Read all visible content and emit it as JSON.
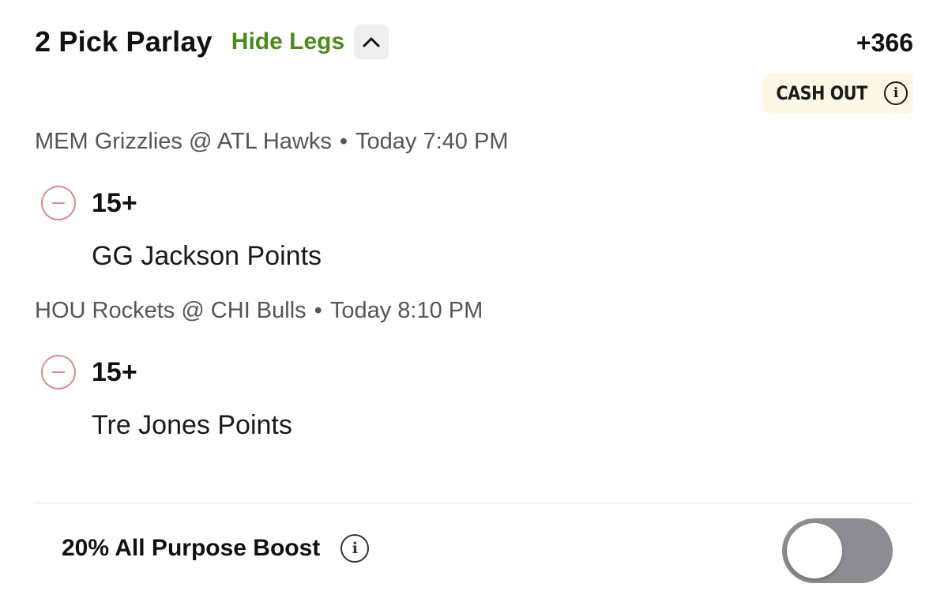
{
  "parlay": {
    "title": "2 Pick Parlay",
    "hide_legs_label": "Hide Legs",
    "chevron_icon": "chevron-up-icon",
    "odds": "+366",
    "cashout_label": "CASH OUT",
    "cashout_info_icon": "info-icon",
    "cashout_info_glyph": "i"
  },
  "legs": [
    {
      "game": "MEM Grizzlies @ ATL Hawks",
      "separator": "•",
      "time": "Today 7:40 PM",
      "line": "15+",
      "player_market": "GG Jackson Points",
      "remove_icon": "minus-circle-icon"
    },
    {
      "game": "HOU Rockets @ CHI Bulls",
      "separator": "•",
      "time": "Today 8:10 PM",
      "line": "15+",
      "player_market": "Tre Jones Points",
      "remove_icon": "minus-circle-icon"
    }
  ],
  "boost": {
    "label": "20% All Purpose Boost",
    "info_icon": "info-icon",
    "info_glyph": "i",
    "toggle_on": false
  },
  "colors": {
    "accent_green": "#4c8a1e",
    "cashout_bg": "#fdf8e6",
    "remove_red": "#d98a8a",
    "toggle_off": "#8c8c92"
  }
}
